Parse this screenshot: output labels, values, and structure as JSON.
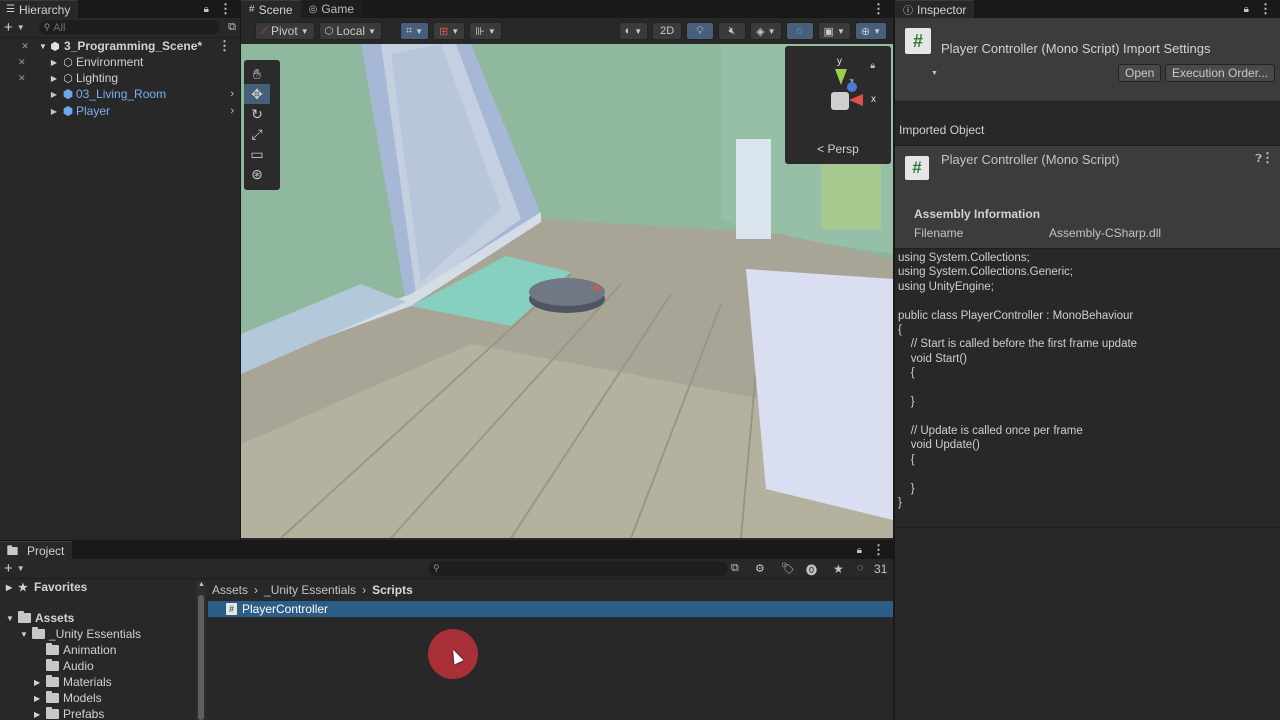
{
  "hierarchy": {
    "tab_label": "Hierarchy",
    "search_placeholder": "All",
    "scene_name": "3_Programming_Scene*",
    "items": [
      {
        "label": "Environment"
      },
      {
        "label": "Lighting"
      },
      {
        "label": "03_Living_Room"
      },
      {
        "label": "Player"
      }
    ]
  },
  "scene_view": {
    "tabs": [
      {
        "label": "Scene"
      },
      {
        "label": "Game"
      }
    ],
    "pivot_label": "Pivot",
    "local_label": "Local",
    "mode_2d_label": "2D",
    "persp_label": "Persp",
    "gizmo_axes": {
      "y": "y",
      "x": "x",
      "z": "z"
    }
  },
  "inspector": {
    "tab_label": "Inspector",
    "title": "Player Controller (Mono Script) Import Settings",
    "open_label": "Open",
    "execution_order_label": "Execution Order...",
    "imported_object_label": "Imported Object",
    "component_title": "Player Controller (Mono Script)",
    "assembly_heading": "Assembly Information",
    "filename_label": "Filename",
    "filename_value": "Assembly-CSharp.dll",
    "code_lines": [
      "using System.Collections;",
      "using System.Collections.Generic;",
      "using UnityEngine;",
      "",
      "public class PlayerController : MonoBehaviour",
      "{",
      "    // Start is called before the first frame update",
      "    void Start()",
      "    {",
      "",
      "    }",
      "",
      "    // Update is called once per frame",
      "    void Update()",
      "    {",
      "",
      "    }",
      "}"
    ]
  },
  "project": {
    "tab_label": "Project",
    "favorites_label": "Favorites",
    "assets_label": "Assets",
    "tree": [
      {
        "label": "_Unity Essentials"
      },
      {
        "label": "Animation"
      },
      {
        "label": "Audio"
      },
      {
        "label": "Materials"
      },
      {
        "label": "Models"
      },
      {
        "label": "Prefabs"
      }
    ],
    "breadcrumb": [
      "Assets",
      "_Unity Essentials",
      "Scripts"
    ],
    "selected_file": "PlayerController",
    "hidden_count": "31"
  },
  "colors": {
    "accent": "#2c5d87",
    "selection": "#2c5d87",
    "click_indicator": "#c0303c"
  }
}
